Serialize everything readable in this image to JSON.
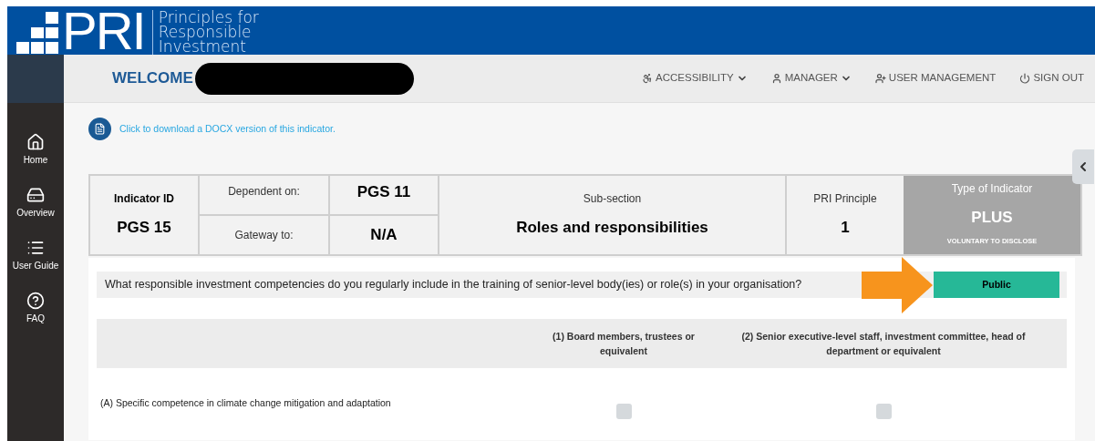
{
  "header": {
    "logo_text": "PRI",
    "tagline": [
      "Principles for",
      "Responsible",
      "Investment"
    ]
  },
  "topbar": {
    "welcome": "WELCOME",
    "redacted": true,
    "nav": [
      {
        "kind": "accessibility",
        "label": "ACCESSIBILITY",
        "dropdown": true
      },
      {
        "kind": "user",
        "label": "MANAGER",
        "dropdown": true
      },
      {
        "kind": "user-add",
        "label": "USER MANAGEMENT",
        "dropdown": false
      },
      {
        "kind": "power",
        "label": "SIGN OUT",
        "dropdown": false
      }
    ]
  },
  "sidebar": {
    "items": [
      {
        "kind": "home",
        "label": "Home"
      },
      {
        "kind": "drive",
        "label": "Overview"
      },
      {
        "kind": "list",
        "label": "User Guide"
      },
      {
        "kind": "help",
        "label": "FAQ"
      }
    ]
  },
  "download_link": "Click to download a DOCX version of this indicator.",
  "indicator": {
    "id_label": "Indicator ID",
    "id": "PGS 15",
    "dependent_label": "Dependent on:",
    "dependent": "PGS 11",
    "gateway_label": "Gateway to:",
    "gateway": "N/A",
    "subsection_label": "Sub-section",
    "subsection": "Roles and responsibilities",
    "principle_label": "PRI Principle",
    "principle": "1",
    "type_label": "Type of Indicator",
    "type": "PLUS",
    "type_note": "VOLUNTARY TO DISCLOSE"
  },
  "question": {
    "text": "What responsible investment competencies do you regularly include in the training of senior-level body(ies) or role(s) in your organisation?",
    "visibility": "Public",
    "highlight_arrow": true
  },
  "matrix": {
    "columns": [
      "(1) Board members, trustees or equivalent",
      "(2) Senior executive-level staff, investment committee, head of department or equivalent"
    ],
    "rows": [
      {
        "label": "(A) Specific competence in climate change mitigation and adaptation",
        "cells": [
          {
            "checked": false
          },
          {
            "checked": false
          }
        ]
      }
    ]
  }
}
